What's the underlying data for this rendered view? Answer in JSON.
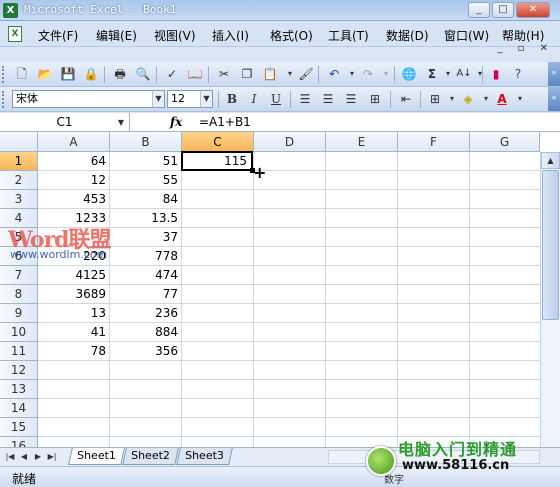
{
  "window": {
    "title": "Microsoft Excel - Book1"
  },
  "menu": [
    "文件(F)",
    "编辑(E)",
    "视图(V)",
    "插入(I)",
    "格式(O)",
    "工具(T)",
    "数据(D)",
    "窗口(W)",
    "帮助(H)"
  ],
  "format_toolbar": {
    "font": "宋体",
    "size": "12"
  },
  "formula_bar": {
    "name_box": "C1",
    "fx_label": "fx",
    "formula": "=A1+B1"
  },
  "grid": {
    "columns": [
      "A",
      "B",
      "C",
      "D",
      "E",
      "F",
      "G"
    ],
    "rows": [
      "1",
      "2",
      "3",
      "4",
      "5",
      "6",
      "7",
      "8",
      "9",
      "10",
      "11",
      "12",
      "13",
      "14",
      "15",
      "16"
    ],
    "col_a": [
      "64",
      "12",
      "453",
      "1233",
      "",
      "220",
      "4125",
      "3689",
      "13",
      "41",
      "78"
    ],
    "col_b": [
      "51",
      "55",
      "84",
      "13.5",
      "37",
      "778",
      "474",
      "77",
      "236",
      "884",
      "356"
    ],
    "c1": "115",
    "selected_column": "C",
    "selected_row": "1"
  },
  "watermark": {
    "line1": "Word联盟",
    "line2": "www.wordlm.com"
  },
  "sheets": {
    "tabs": [
      "Sheet1",
      "Sheet2",
      "Sheet3"
    ],
    "active": "Sheet1"
  },
  "status": {
    "ready": "就绪",
    "num": "数字"
  },
  "logo": {
    "title": "电脑入门到精通",
    "url": "www.58116.cn"
  }
}
